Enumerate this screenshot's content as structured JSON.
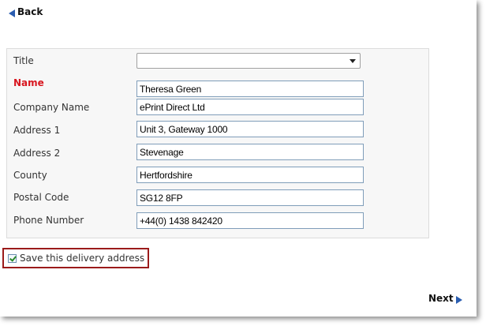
{
  "nav": {
    "back_label": "Back",
    "next_label": "Next"
  },
  "form": {
    "title_label": "Title",
    "title_value": "",
    "name_label": "Name",
    "name_value": "Theresa Green",
    "company_label": "Company Name",
    "company_value": "ePrint Direct Ltd",
    "address1_label": "Address 1",
    "address1_value": "Unit 3, Gateway 1000",
    "address2_label": "Address 2",
    "address2_value": "Stevenage",
    "county_label": "County",
    "county_value": "Hertfordshire",
    "postal_label": "Postal Code",
    "postal_value": "SG12 8FP",
    "phone_label": "Phone Number",
    "phone_value": "+44(0) 1438 842420"
  },
  "save": {
    "label": "Save this delivery address",
    "checked": true
  },
  "icons": {
    "back": "arrow-left-icon",
    "next": "arrow-right-icon",
    "dropdown": "chevron-down-icon",
    "checkbox": "checkmark-icon"
  },
  "colors": {
    "required_label": "#d8161f",
    "nav_arrow": "#2a5db0",
    "highlight_border": "#9b1b1b"
  }
}
